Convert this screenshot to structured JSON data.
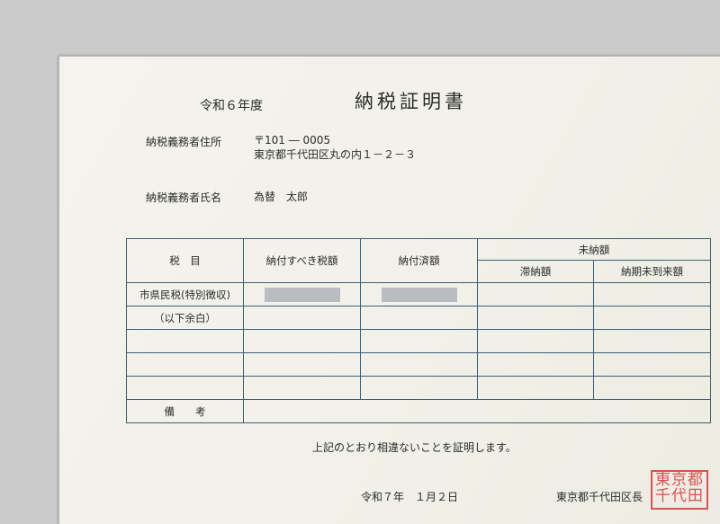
{
  "document": {
    "era": "令和６年度",
    "title": "納税証明書",
    "address_label": "納税義務者住所",
    "postal": "〒101 ― 0005",
    "address": "東京都千代田区丸の内１－２－３",
    "name_label": "納税義務者氏名",
    "name": "為替　太郎"
  },
  "table": {
    "headers": {
      "item": "税　目",
      "amount_due": "納付すべき税額",
      "paid": "納付済額",
      "unpaid": "未納額",
      "overdue": "滞納額",
      "not_yet_due": "納期未到来額"
    },
    "rows": [
      {
        "item": "市県民税(特別徴収)"
      },
      {
        "item": "（以下余白）"
      },
      {
        "item": ""
      },
      {
        "item": ""
      },
      {
        "item": ""
      }
    ],
    "remarks_label": "備　　考"
  },
  "footer": {
    "certification": "上記のとおり相違ないことを証明します。",
    "date": "令和７年　１月２日",
    "issuer": "東京都千代田区長",
    "seal_text": "東京都千代田区長"
  }
}
